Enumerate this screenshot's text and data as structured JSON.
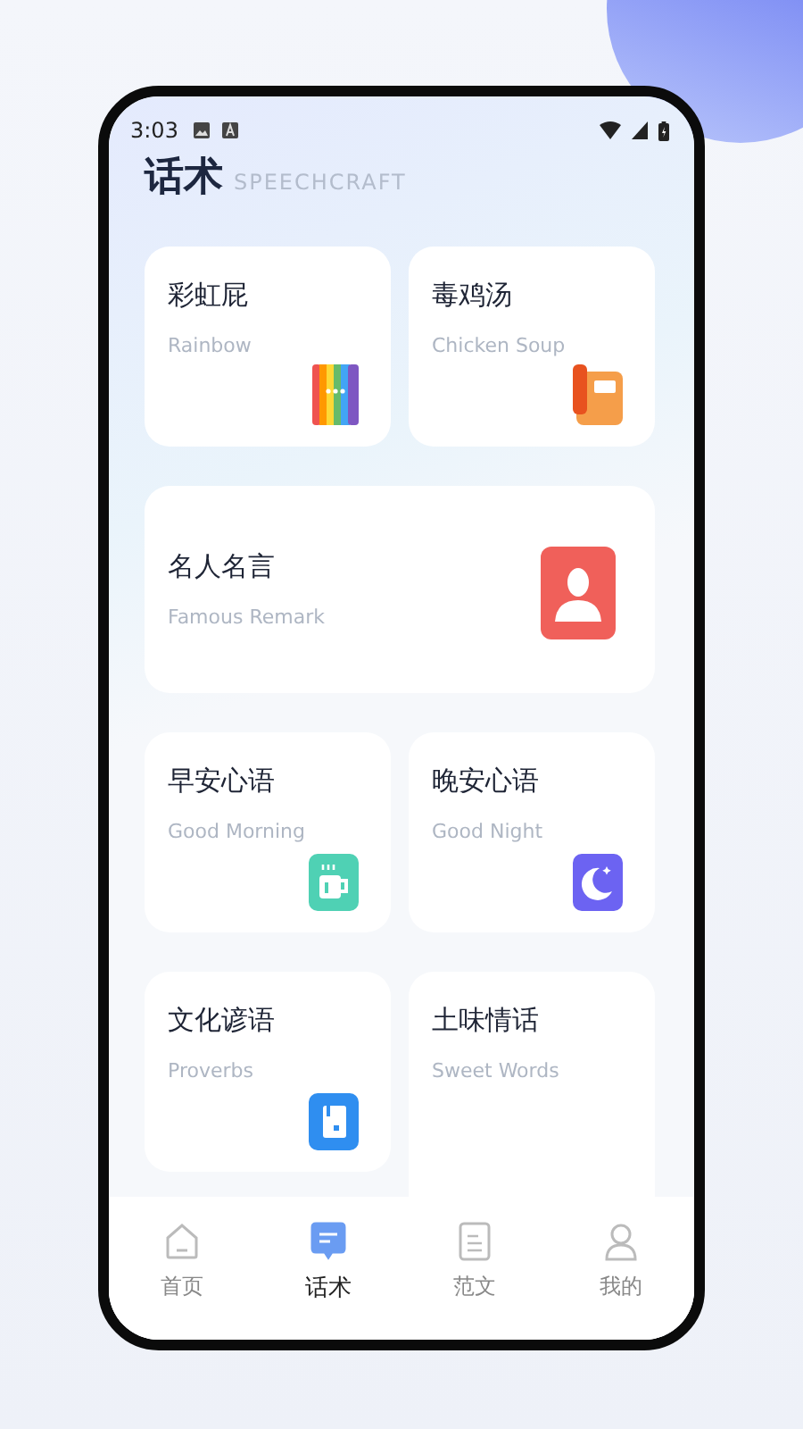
{
  "status_bar": {
    "time": "3:03"
  },
  "header": {
    "title": "话术",
    "subtitle": "SPEECHCRAFT"
  },
  "cards": [
    {
      "kind": "small",
      "title": "彩虹屁",
      "subtitle": "Rainbow"
    },
    {
      "kind": "small",
      "title": "毒鸡汤",
      "subtitle": "Chicken Soup"
    },
    {
      "kind": "wide",
      "title": "名人名言",
      "subtitle": "Famous Remark"
    },
    {
      "kind": "small",
      "title": "早安心语",
      "subtitle": "Good Morning"
    },
    {
      "kind": "small",
      "title": "晚安心语",
      "subtitle": "Good Night"
    },
    {
      "kind": "small",
      "title": "文化谚语",
      "subtitle": "Proverbs"
    },
    {
      "kind": "tall",
      "title": "土味情话",
      "subtitle": "Sweet Words"
    }
  ],
  "tabs": [
    {
      "label": "首页",
      "selected": false
    },
    {
      "label": "话术",
      "selected": true
    },
    {
      "label": "范文",
      "selected": false
    },
    {
      "label": "我的",
      "selected": false
    }
  ]
}
